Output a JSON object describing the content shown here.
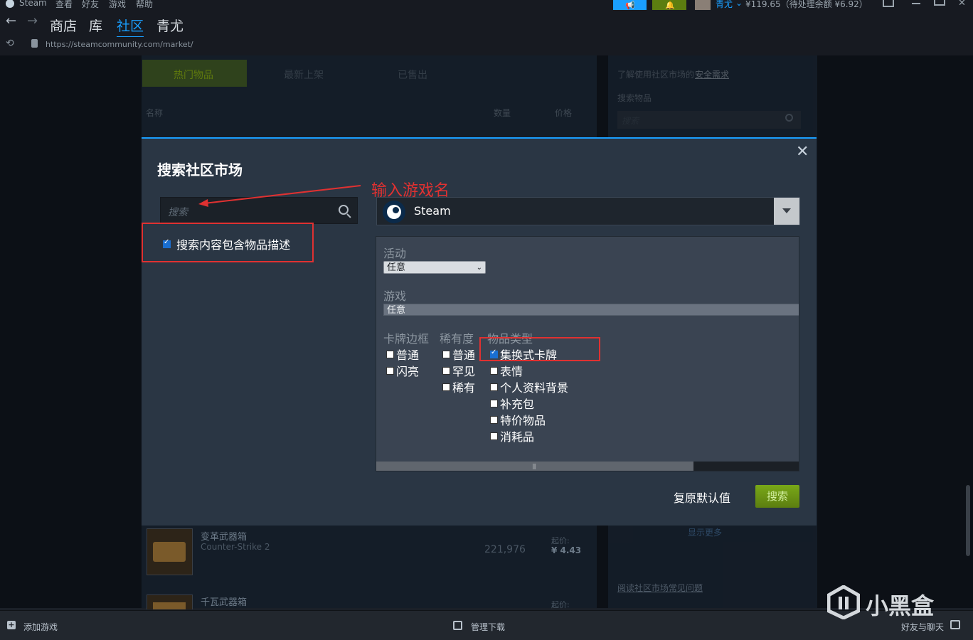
{
  "topbar": {
    "app": "Steam",
    "menus": [
      "查看",
      "好友",
      "游戏",
      "帮助"
    ],
    "user": "青尤",
    "wallet": "¥119.65（待处理余额 ¥6.92）"
  },
  "nav": {
    "links": [
      "商店",
      "库",
      "社区",
      "青尤"
    ],
    "active": "社区",
    "url": "https://steamcommunity.com/market/"
  },
  "background": {
    "tabs": [
      "热门物品",
      "最新上架",
      "已售出"
    ],
    "columns": [
      "名称",
      "数量",
      "价格"
    ],
    "rows": [
      {
        "name": "变革武器箱",
        "game": "Counter-Strike 2",
        "qty": "221,976",
        "price_label": "起价:",
        "price": "¥ 4.43"
      },
      {
        "name": "千瓦武器箱",
        "game": "",
        "qty": "",
        "price_label": "起价:",
        "price": ""
      }
    ],
    "side": {
      "safety_text": "了解使用社区市场的",
      "safety_link": "安全需求",
      "search_label": "搜索物品",
      "search_placeholder": "搜索",
      "show_more": "显示更多",
      "faq_link": "阅读社区市场常见问题"
    }
  },
  "modal": {
    "title": "搜索社区市场",
    "search_placeholder": "搜索",
    "include_desc_label": "搜索内容包含物品描述",
    "include_desc_checked": true,
    "game": "Steam",
    "filters": {
      "activity_label": "活动",
      "activity_value": "任意",
      "game_label": "游戏",
      "game_value": "任意",
      "card_border": {
        "label": "卡牌边框",
        "options": [
          "普通",
          "闪亮"
        ]
      },
      "rarity": {
        "label": "稀有度",
        "options": [
          "普通",
          "罕见",
          "稀有"
        ]
      },
      "item_type": {
        "label": "物品类型",
        "options": [
          "集换式卡牌",
          "表情",
          "个人资料背景",
          "补充包",
          "特价物品",
          "消耗品"
        ],
        "checked": [
          "集换式卡牌"
        ]
      }
    },
    "reset_label": "复原默认值",
    "search_label": "搜索"
  },
  "annotation": "输入游戏名",
  "bottombar": {
    "add_game": "添加游戏",
    "downloads": "管理下载",
    "friends": "好友与聊天"
  },
  "watermark": "小黑盒",
  "colors": {
    "accent": "#1a9fff",
    "annotation": "#e03131",
    "search_button": "#6b9114"
  }
}
